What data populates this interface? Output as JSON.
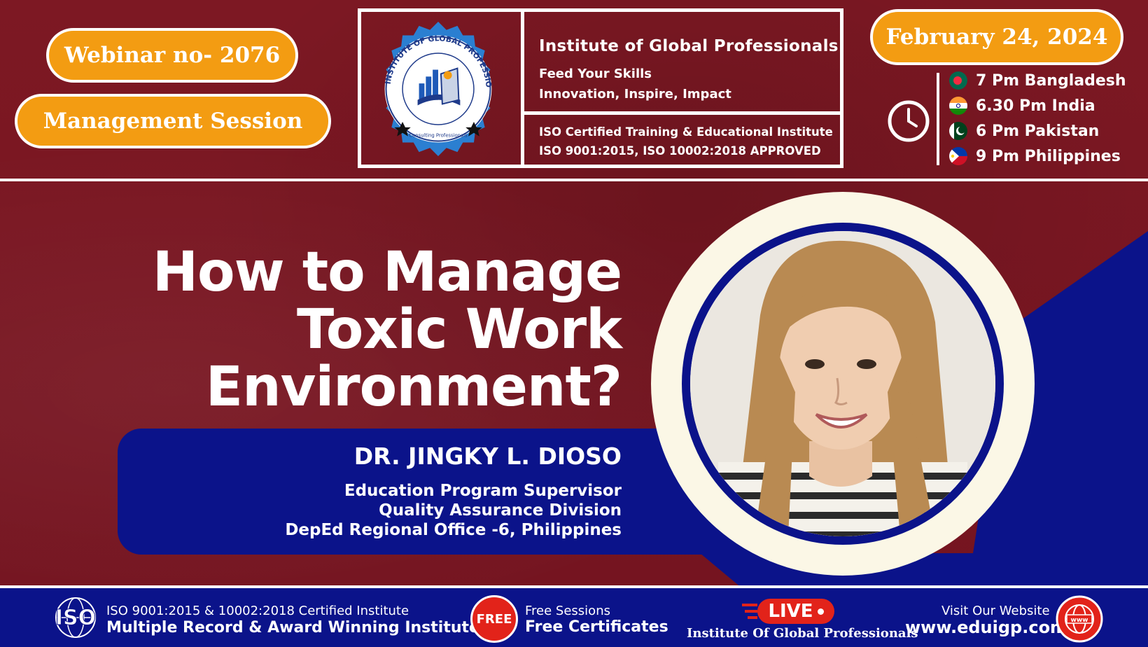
{
  "header": {
    "webinar_label": "Webinar no- 2076",
    "session_label": "Management Session",
    "date_label": "February 24, 2024"
  },
  "org": {
    "name": "Institute of Global Professionals",
    "tagline1": "Feed Your Skills",
    "tagline2": "Innovation, Inspire, Impact",
    "iso_line1": "ISO Certified Training & Educational Institute",
    "iso_line2": "ISO 9001:2015, ISO 10002:2018  APPROVED",
    "seal_text": "INSTITUTE OF GLOBAL PROFESSIONALS",
    "seal_sub": "Consulting Professionals"
  },
  "timezones": [
    {
      "label": "7 Pm Bangladesh",
      "flag": "bangladesh-flag"
    },
    {
      "label": "6.30 Pm India",
      "flag": "india-flag"
    },
    {
      "label": "6 Pm Pakistan",
      "flag": "pakistan-flag"
    },
    {
      "label": "9 Pm Philippines",
      "flag": "philippines-flag"
    }
  ],
  "title": {
    "line1": "How to Manage",
    "line2": "Toxic Work",
    "line3": "Environment?"
  },
  "speaker": {
    "name": "DR. JINGKY L. DIOSO",
    "role1": "Education Program Supervisor",
    "role2": "Quality Assurance Division",
    "role3": "DepEd Regional Office -6, Philippines"
  },
  "footer": {
    "iso_mark": "ISO",
    "iso_small": "ISO 9001:2015 & 10002:2018 Certified Institute",
    "iso_big": "Multiple Record & Award Winning Institute",
    "free_badge": "FREE",
    "free_small": "Free Sessions",
    "free_big": "Free Certificates",
    "live_label": "LIVE",
    "live_org": "Institute Of Global Professionals",
    "web_small": "Visit Our Website",
    "web_big": "www.eduigp.com",
    "globe_text": "www"
  },
  "colors": {
    "maroon": "#7a1621",
    "navy": "#0b138a",
    "orange": "#f39c12",
    "red": "#e2231a",
    "cream": "#fbf7e6"
  }
}
